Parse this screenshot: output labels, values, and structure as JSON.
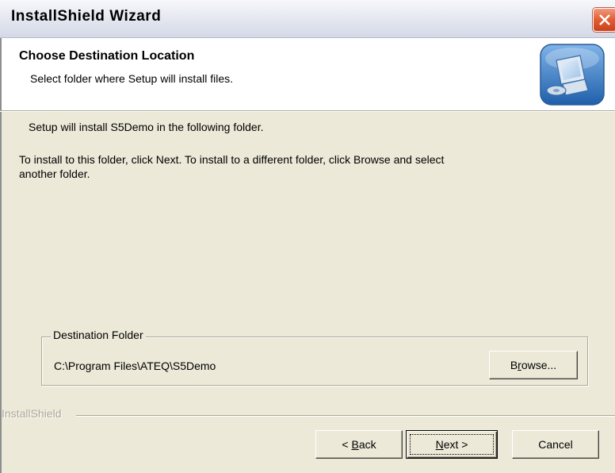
{
  "window": {
    "title": "InstallShield Wizard"
  },
  "header": {
    "title": "Choose Destination Location",
    "subtitle": "Select folder where Setup will install files.",
    "icon": "install-computer-icon"
  },
  "body": {
    "line1": "Setup will install S5Demo in the following folder.",
    "line2a": "To install to this folder, click Next. To install to a different folder, click Browse and select",
    "line2b": "another folder."
  },
  "destination": {
    "legend": "Destination Folder",
    "path": "C:\\Program Files\\ATEQ\\S5Demo",
    "browse_pre": "B",
    "browse_mnemonic": "r",
    "browse_post": "owse..."
  },
  "footer": {
    "brand": "InstallShield",
    "back_pre": "< ",
    "back_mnemonic": "B",
    "back_post": "ack",
    "next_mnemonic": "N",
    "next_post": "ext >",
    "cancel_label": "Cancel"
  },
  "colors": {
    "dialog_bg": "#ece9d8",
    "close_red": "#e25c33"
  }
}
